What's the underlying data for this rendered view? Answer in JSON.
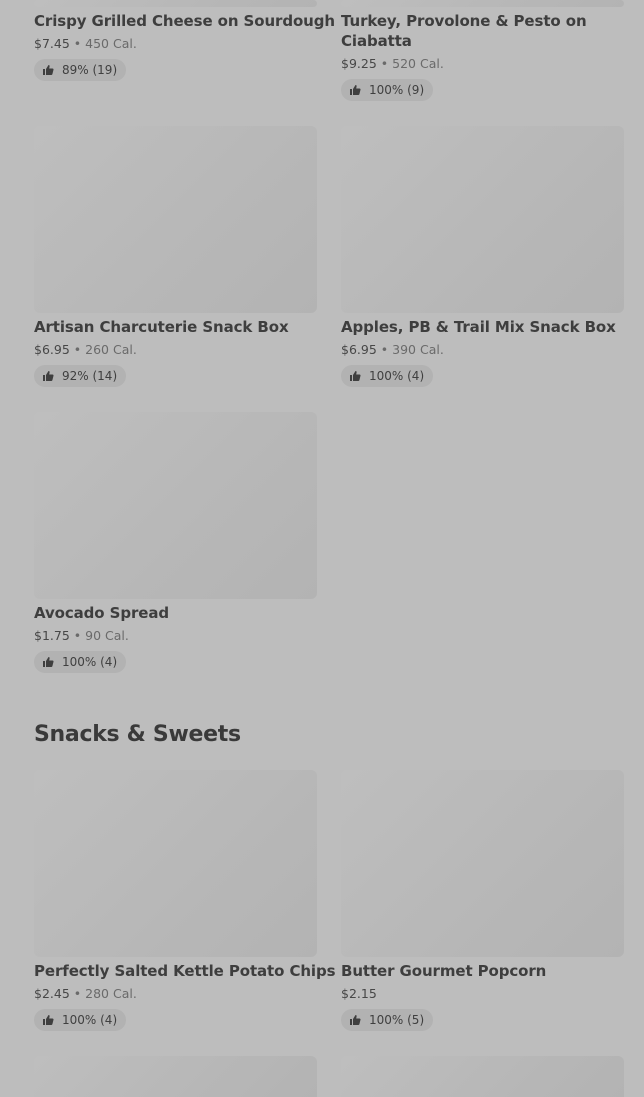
{
  "items": [
    {
      "title": "Crispy Grilled Cheese on Sourdough",
      "price": "$7.45",
      "sep": "•",
      "calories": "450 Cal.",
      "rating": "89% (19)"
    },
    {
      "title": "Turkey, Provolone & Pesto on Ciabatta",
      "price": "$9.25",
      "sep": "•",
      "calories": "520 Cal.",
      "rating": "100% (9)"
    },
    {
      "title": "Artisan Charcuterie Snack Box",
      "price": "$6.95",
      "sep": "•",
      "calories": "260 Cal.",
      "rating": "92% (14)"
    },
    {
      "title": "Apples, PB & Trail Mix Snack Box",
      "price": "$6.95",
      "sep": "•",
      "calories": "390 Cal.",
      "rating": "100% (4)"
    },
    {
      "title": "Avocado Spread",
      "price": "$1.75",
      "sep": "•",
      "calories": "90 Cal.",
      "rating": "100% (4)"
    },
    {
      "title": "Perfectly Salted Kettle Potato Chips",
      "price": "$2.45",
      "sep": "•",
      "calories": "280 Cal.",
      "rating": "100% (4)"
    },
    {
      "title": "Butter Gourmet Popcorn",
      "price": "$2.15",
      "sep": "",
      "calories": "",
      "rating": "100% (5)"
    }
  ],
  "sections": {
    "snacks_title": "Snacks & Sweets"
  },
  "icons": {
    "rating": "thumbs-up-icon"
  },
  "colors": {
    "background": "#bdbdbd",
    "pill": "#b2b2b2",
    "text": "#3e3e3e"
  }
}
